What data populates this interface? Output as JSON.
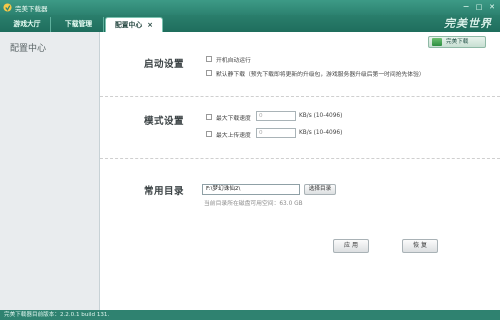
{
  "window": {
    "title": "完美下载器",
    "controls": {
      "minimize": "−",
      "maximize": "□",
      "close": "✕"
    },
    "brand": "完美世界"
  },
  "tabs": [
    {
      "label": "游戏大厅"
    },
    {
      "label": "下载管理"
    },
    {
      "label": "配置中心",
      "close": "×"
    }
  ],
  "sidebar": {
    "items": [
      {
        "label": "配置中心"
      }
    ]
  },
  "skin_button": {
    "label": "完美下载"
  },
  "startup": {
    "title": "启动设置",
    "autostart_label": "开机自动运行",
    "silent_label": "默认静下载（预先下载即将更新的升级包，游戏服务器升级后第一时间抢先体验）"
  },
  "mode": {
    "title": "模式设置",
    "max_download": {
      "label": "最大下载速度",
      "value": "0",
      "unit": "KB/s (10-4096)"
    },
    "max_upload": {
      "label": "最大上传速度",
      "value": "0",
      "unit": "KB/s (10-4096)"
    }
  },
  "directory": {
    "title": "常用目录",
    "path": "F:\\梦幻诛仙2\\",
    "browse_label": "选择目录",
    "free_space": "当前目录所在磁盘可用空间：63.0 GB"
  },
  "actions": {
    "apply": "应 用",
    "restore": "恢 复"
  },
  "status": {
    "version": "完美下载器目前版本：2.2.0.1  build 131."
  },
  "colors": {
    "titlebar": "#2c8270",
    "tabbar": "#1f6e5d",
    "sidebar": "#e9ecee",
    "statusbar": "#2f8270"
  }
}
